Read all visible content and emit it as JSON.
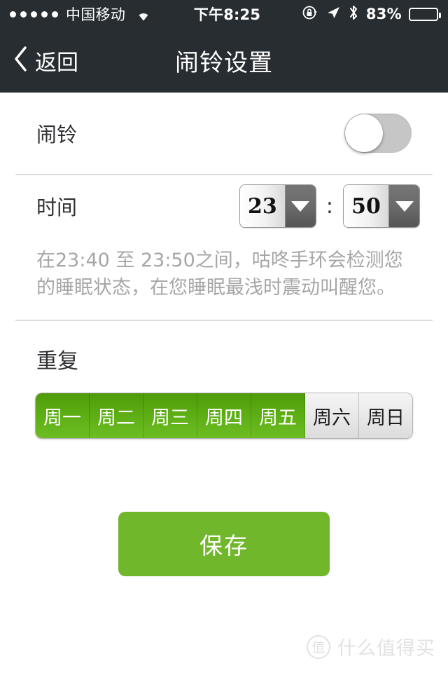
{
  "statusbar": {
    "signal_dots": 5,
    "carrier": "中国移动",
    "wifi_icon": "wifi-icon",
    "time": "下午8:25",
    "rotation_lock_icon": "rotation-lock-icon",
    "location_icon": "location-arrow-icon",
    "bluetooth_icon": "bluetooth-icon",
    "battery_percent": "83%",
    "battery_level": 83
  },
  "navbar": {
    "back_label": "返回",
    "back_icon": "chevron-left-icon",
    "title": "闹铃设置"
  },
  "alarm_row": {
    "label": "闹铃",
    "toggle_on": false
  },
  "time_row": {
    "label": "时间",
    "hour": "23",
    "separator": ":",
    "minute": "50",
    "hour_arrow_icon": "chevron-down-icon",
    "minute_arrow_icon": "chevron-down-icon"
  },
  "description": "在23:40 至 23:50之间，咕咚手环会检测您的睡眠状态，在您睡眠最浅时震动叫醒您。",
  "repeat": {
    "title": "重复",
    "days": [
      {
        "label": "周一",
        "selected": true
      },
      {
        "label": "周二",
        "selected": true
      },
      {
        "label": "周三",
        "selected": true
      },
      {
        "label": "周四",
        "selected": true
      },
      {
        "label": "周五",
        "selected": true
      },
      {
        "label": "周六",
        "selected": false
      },
      {
        "label": "周日",
        "selected": false
      }
    ]
  },
  "save": {
    "label": "保存"
  },
  "watermark": {
    "logo_text": "值",
    "text": "什么值得买"
  },
  "colors": {
    "navbar_bg": "#282d31",
    "accent_green": "#70b72c",
    "segment_green_top": "#4f9a0b",
    "segment_green_bottom": "#6cbd23",
    "toggle_off": "#c6c6c6",
    "divider": "#dddddd",
    "description_text": "#a6a6a6"
  }
}
